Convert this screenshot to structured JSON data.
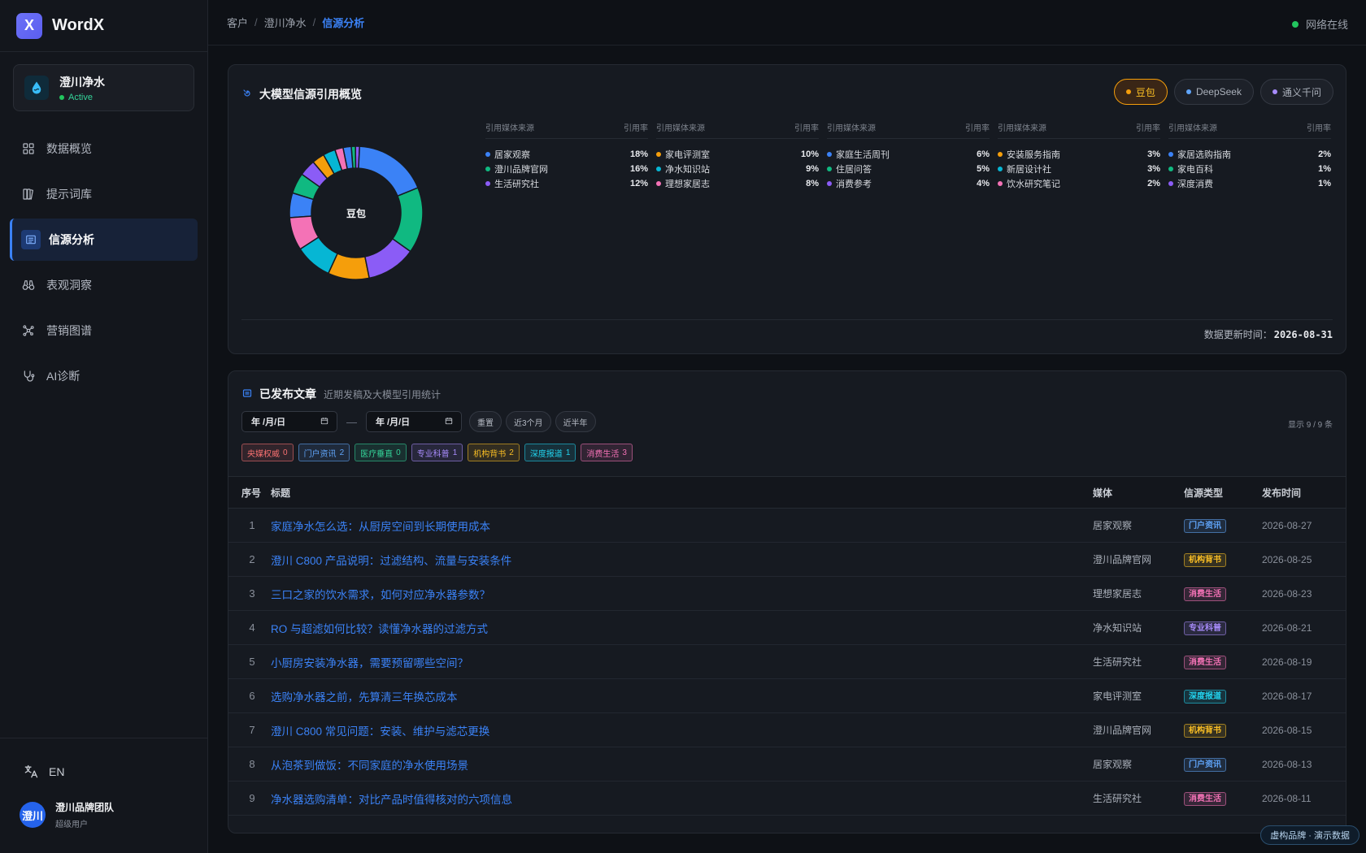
{
  "brand": {
    "logo_letter": "X",
    "name": "WordX"
  },
  "client": {
    "name": "澄川净水",
    "status": "Active"
  },
  "nav": [
    {
      "label": "数据概览",
      "icon": "grid-icon",
      "active": false
    },
    {
      "label": "提示词库",
      "icon": "book-icon",
      "active": false
    },
    {
      "label": "信源分析",
      "icon": "list-icon",
      "active": true
    },
    {
      "label": "表观洞察",
      "icon": "binoculars-icon",
      "active": false
    },
    {
      "label": "营销图谱",
      "icon": "graph-icon",
      "active": false
    },
    {
      "label": "AI诊断",
      "icon": "stethoscope-icon",
      "active": false
    }
  ],
  "lang": {
    "label": "EN"
  },
  "user": {
    "avatar": "澄川",
    "name": "澄川品牌团队",
    "role": "超级用户"
  },
  "breadcrumb": [
    "客户",
    "澄川净水",
    "信源分析"
  ],
  "network": {
    "label": "网络在线",
    "color": "#22c55e"
  },
  "overview": {
    "title": "大模型信源引用概览",
    "models": [
      {
        "label": "豆包",
        "color": "#f59e0b",
        "active": true
      },
      {
        "label": "DeepSeek",
        "color": "#60a5fa",
        "active": false
      },
      {
        "label": "通义千问",
        "color": "#a78bfa",
        "active": false
      }
    ],
    "donut_center": "豆包",
    "legend_head_source": "引用媒体来源",
    "legend_head_rate": "引用率",
    "updated_label": "数据更新时间：",
    "updated_value": "2026-08-31"
  },
  "chart_data": {
    "type": "pie",
    "title": "",
    "center_label": "豆包",
    "slices": [
      {
        "name": "居家观察",
        "value": 18,
        "label": "18%",
        "color": "#3b82f6"
      },
      {
        "name": "澄川品牌官网",
        "value": 16,
        "label": "16%",
        "color": "#10b981"
      },
      {
        "name": "生活研究社",
        "value": 12,
        "label": "12%",
        "color": "#8b5cf6"
      },
      {
        "name": "家电评测室",
        "value": 10,
        "label": "10%",
        "color": "#f59e0b"
      },
      {
        "name": "净水知识站",
        "value": 9,
        "label": "9%",
        "color": "#06b6d4"
      },
      {
        "name": "理想家居志",
        "value": 8,
        "label": "8%",
        "color": "#f472b6"
      },
      {
        "name": "家庭生活周刊",
        "value": 6,
        "label": "6%",
        "color": "#3b82f6"
      },
      {
        "name": "住居问答",
        "value": 5,
        "label": "5%",
        "color": "#10b981"
      },
      {
        "name": "消费参考",
        "value": 4,
        "label": "4%",
        "color": "#8b5cf6"
      },
      {
        "name": "安装服务指南",
        "value": 3,
        "label": "3%",
        "color": "#f59e0b"
      },
      {
        "name": "新居设计社",
        "value": 3,
        "label": "3%",
        "color": "#06b6d4"
      },
      {
        "name": "饮水研究笔记",
        "value": 2,
        "label": "2%",
        "color": "#f472b6"
      },
      {
        "name": "家居选购指南",
        "value": 2,
        "label": "2%",
        "color": "#3b82f6"
      },
      {
        "name": "家电百科",
        "value": 1,
        "label": "1%",
        "color": "#10b981"
      },
      {
        "name": "深度消费",
        "value": 1,
        "label": "1%",
        "color": "#8b5cf6"
      }
    ]
  },
  "articles": {
    "title": "已发布文章",
    "subtitle": "近期发稿及大模型引用统计",
    "date_from": "年 /月/日",
    "date_to": "年 /月/日",
    "date_sep": "—",
    "buttons": [
      "重置",
      "近3个月",
      "近半年"
    ],
    "count_text": "显示 9 / 9 条",
    "tags": [
      {
        "label": "央媒权威",
        "count": "0",
        "color": "#f87171"
      },
      {
        "label": "门户资讯",
        "count": "2",
        "color": "#60a5fa"
      },
      {
        "label": "医疗垂直",
        "count": "0",
        "color": "#34d399"
      },
      {
        "label": "专业科普",
        "count": "1",
        "color": "#a78bfa"
      },
      {
        "label": "机构背书",
        "count": "2",
        "color": "#fbbf24"
      },
      {
        "label": "深度报道",
        "count": "1",
        "color": "#22d3ee"
      },
      {
        "label": "消费生活",
        "count": "3",
        "color": "#f472b6"
      }
    ],
    "columns": {
      "idx": "序号",
      "title": "标题",
      "media": "媒体",
      "type": "信源类型",
      "date": "发布时间"
    },
    "rows": [
      {
        "idx": "1",
        "title": "家庭净水怎么选：从厨房空间到长期使用成本",
        "media": "居家观察",
        "type": "门户资讯",
        "type_color": "#60a5fa",
        "date": "2026-08-27"
      },
      {
        "idx": "2",
        "title": "澄川 C800 产品说明：过滤结构、流量与安装条件",
        "media": "澄川品牌官网",
        "type": "机构背书",
        "type_color": "#fbbf24",
        "date": "2026-08-25"
      },
      {
        "idx": "3",
        "title": "三口之家的饮水需求，如何对应净水器参数？",
        "media": "理想家居志",
        "type": "消费生活",
        "type_color": "#f472b6",
        "date": "2026-08-23"
      },
      {
        "idx": "4",
        "title": "RO 与超滤如何比较？读懂净水器的过滤方式",
        "media": "净水知识站",
        "type": "专业科普",
        "type_color": "#a78bfa",
        "date": "2026-08-21"
      },
      {
        "idx": "5",
        "title": "小厨房安装净水器，需要预留哪些空间？",
        "media": "生活研究社",
        "type": "消费生活",
        "type_color": "#f472b6",
        "date": "2026-08-19"
      },
      {
        "idx": "6",
        "title": "选购净水器之前，先算清三年换芯成本",
        "media": "家电评测室",
        "type": "深度报道",
        "type_color": "#22d3ee",
        "date": "2026-08-17"
      },
      {
        "idx": "7",
        "title": "澄川 C800 常见问题：安装、维护与滤芯更换",
        "media": "澄川品牌官网",
        "type": "机构背书",
        "type_color": "#fbbf24",
        "date": "2026-08-15"
      },
      {
        "idx": "8",
        "title": "从泡茶到做饭：不同家庭的净水使用场景",
        "media": "居家观察",
        "type": "门户资讯",
        "type_color": "#60a5fa",
        "date": "2026-08-13"
      },
      {
        "idx": "9",
        "title": "净水器选购清单：对比产品时值得核对的六项信息",
        "media": "生活研究社",
        "type": "消费生活",
        "type_color": "#f472b6",
        "date": "2026-08-11"
      }
    ]
  },
  "demo_badge": "虚构品牌 · 演示数据"
}
